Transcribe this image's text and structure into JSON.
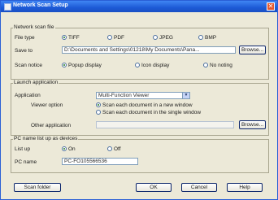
{
  "window": {
    "title": "Network Scan Setup",
    "close_glyph": "✕"
  },
  "scan_file": {
    "group_label": "Network scan file",
    "file_type_label": "File type",
    "file_types": [
      {
        "label": "TIFF",
        "selected": true
      },
      {
        "label": "PDF",
        "selected": false
      },
      {
        "label": "JPEG",
        "selected": false
      },
      {
        "label": "BMP",
        "selected": false
      }
    ],
    "save_to_label": "Save to",
    "save_to_value": "D:\\Documents and Settings\\01218\\My Documents\\Pana...",
    "browse_label": "Browse...",
    "scan_notice_label": "Scan notice",
    "scan_notices": [
      {
        "label": "Popup display",
        "selected": true
      },
      {
        "label": "Icon display",
        "selected": false
      },
      {
        "label": "No noting",
        "selected": false
      }
    ]
  },
  "launch": {
    "group_label": "Launch application",
    "application_label": "Application",
    "application_value": "Multi-Function Viewer",
    "viewer_option_label": "Viewer option",
    "viewer_options": [
      {
        "label": "Scan each document in a new window",
        "selected": true
      },
      {
        "label": "Scan each document in the single window",
        "selected": false
      }
    ],
    "other_app_label": "Other application",
    "other_app_value": "",
    "browse_label": "Browse..."
  },
  "pc_name": {
    "group_label": "PC name list up as devices",
    "list_up_label": "List up",
    "options": [
      {
        "label": "On",
        "selected": true
      },
      {
        "label": "Off",
        "selected": false
      }
    ],
    "pc_name_label": "PC name",
    "pc_name_value": "PC-FO105566536"
  },
  "footer": {
    "scan_folder_label": "Scan folder",
    "ok_label": "OK",
    "cancel_label": "Cancel",
    "help_label": "Help"
  }
}
